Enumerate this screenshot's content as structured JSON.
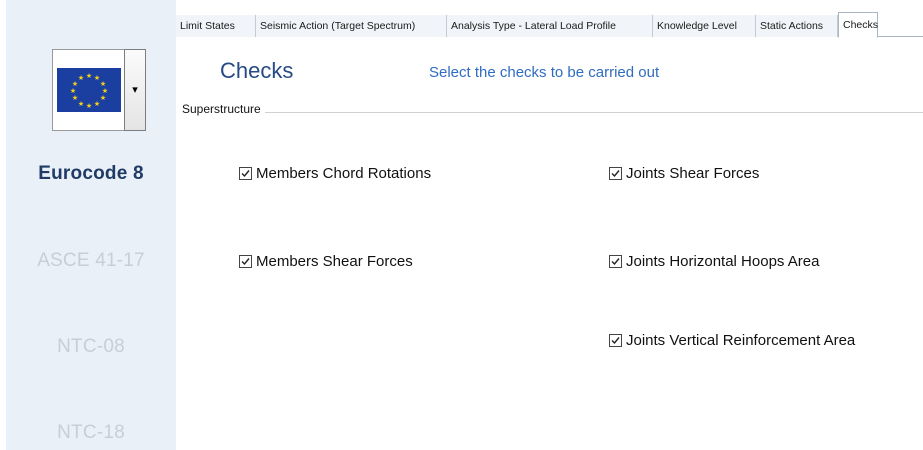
{
  "sidebar": {
    "flag_icon": "eu-flag-icon",
    "dropdown_icon": "chevron-down-icon",
    "codes": [
      {
        "label": "Eurocode 8",
        "active": true
      },
      {
        "label": "ASCE 41-17",
        "active": false
      },
      {
        "label": "NTC-08",
        "active": false
      },
      {
        "label": "NTC-18",
        "active": false
      }
    ]
  },
  "tabs": [
    {
      "label": "Limit States",
      "selected": false
    },
    {
      "label": "Seismic Action (Target Spectrum)",
      "selected": false
    },
    {
      "label": "Analysis  Type - Lateral Load Profile",
      "selected": false
    },
    {
      "label": "Knowledge Level",
      "selected": false
    },
    {
      "label": "Static Actions",
      "selected": false
    },
    {
      "label": "Checks",
      "selected": true
    }
  ],
  "main": {
    "title": "Checks",
    "subtitle": "Select the checks to be carried out",
    "group_label": "Superstructure",
    "checks": [
      {
        "label": "Members Chord Rotations",
        "checked": true
      },
      {
        "label": "Members Shear Forces",
        "checked": true
      },
      {
        "label": "Joints Shear Forces",
        "checked": true
      },
      {
        "label": "Joints Horizontal Hoops Area",
        "checked": true
      },
      {
        "label": "Joints Vertical Reinforcement Area",
        "checked": true
      }
    ]
  },
  "colors": {
    "title": "#264a86",
    "subtitle": "#2f6cc0",
    "active_code": "#1f3b66",
    "inactive_code": "#c6ced9",
    "sidebar_bg": "#eaf0f7"
  }
}
